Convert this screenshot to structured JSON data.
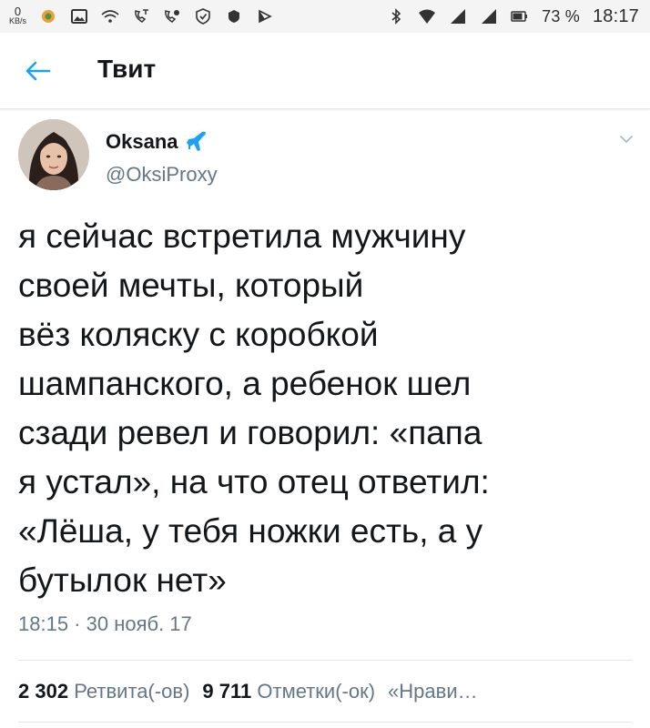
{
  "status_bar": {
    "speed_value": "0",
    "speed_unit": "KB/s",
    "battery_percent": "73 %",
    "time": "18:17",
    "left_icons": [
      "notification-app-icon",
      "image-icon",
      "wifi-question-icon",
      "missed-call-icon",
      "voicemail-icon",
      "shield-icon",
      "dot-icon",
      "play-icon"
    ],
    "right_icons": [
      "bluetooth-icon",
      "wifi-icon",
      "signal-icon",
      "signal-icon",
      "battery-icon"
    ]
  },
  "header": {
    "title": "Твит",
    "back_icon": "back-arrow-icon",
    "accent": "#1da1f2"
  },
  "tweet": {
    "author_name": "Oksana",
    "author_badge_icon": "airplane-icon",
    "author_handle": "@OksiProxy",
    "text_lines": [
      "я сейчас встретила мужчину",
      "своей мечты, который",
      "вёз коляску с коробкой",
      "шампанского, а ребенок шел",
      "сзади ревел и говорил: «папа",
      "я устал», на что отец ответил:",
      "«Лёша, у тебя ножки есть, а у",
      "бутылок нет»"
    ],
    "timestamp": "18:15 · 30 нояб. 17",
    "retweets_count": "2 302",
    "retweets_label": "Ретвита(-ов)",
    "likes_count": "9 711",
    "likes_label": "Отметки(-ок)",
    "third_stat_label": "«Нрави…"
  }
}
